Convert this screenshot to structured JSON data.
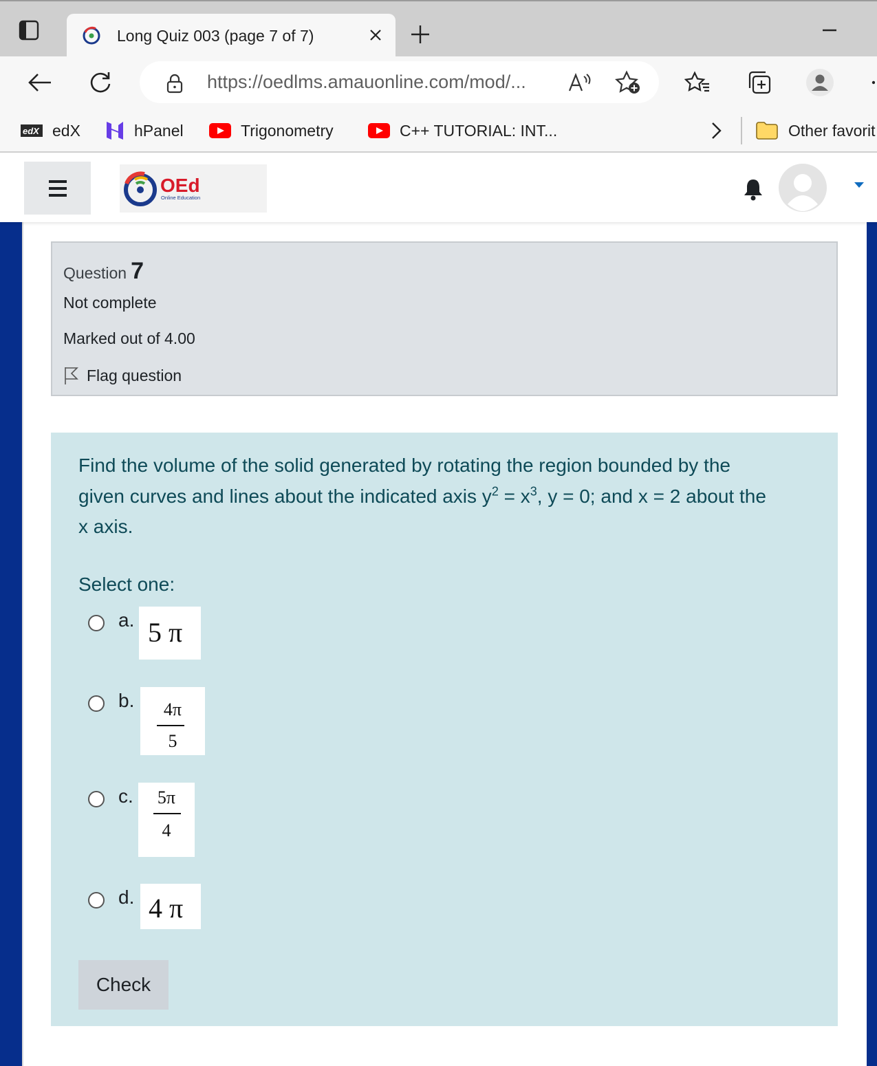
{
  "browser": {
    "tab_title": "Long Quiz 003 (page 7 of 7)",
    "url": "https://oedlms.amauonline.com/mod/...",
    "bookmarks": [
      {
        "label": "edX",
        "icon": "edx-icon"
      },
      {
        "label": "hPanel",
        "icon": "hpanel-icon"
      },
      {
        "label": "Trigonometry",
        "icon": "youtube-icon"
      },
      {
        "label": "C++ TUTORIAL: INT...",
        "icon": "youtube-icon"
      }
    ],
    "other_favorites": "Other favorit",
    "logo_text": "OEd",
    "logo_subtext": "Online Education"
  },
  "question": {
    "label": "Question",
    "number": "7",
    "state": "Not complete",
    "grade": "Marked out of 4.00",
    "flag_label": "Flag question",
    "text_line1": "Find the volume of the solid generated by rotating the region bounded by the",
    "text_line2_pre": "given curves and lines about the indicated axis y",
    "exp_y": "2",
    "text_eq": " = x",
    "exp_x": "3",
    "text_line2_post": ", y = 0; and x = 2 about the",
    "text_line3": "x axis.",
    "prompt": "Select one:",
    "options": [
      {
        "letter": "a.",
        "answer": "5 π"
      },
      {
        "letter": "b.",
        "numerator": "4π",
        "denominator": "5"
      },
      {
        "letter": "c.",
        "numerator": "5π",
        "denominator": "4"
      },
      {
        "letter": "d.",
        "answer": "4 π"
      }
    ],
    "check_label": "Check"
  },
  "colors": {
    "accent_sidebar": "#062e8c",
    "info_box": "#dee2e6",
    "formulation_box": "#cfe6ea",
    "question_text": "#0e4a57"
  }
}
